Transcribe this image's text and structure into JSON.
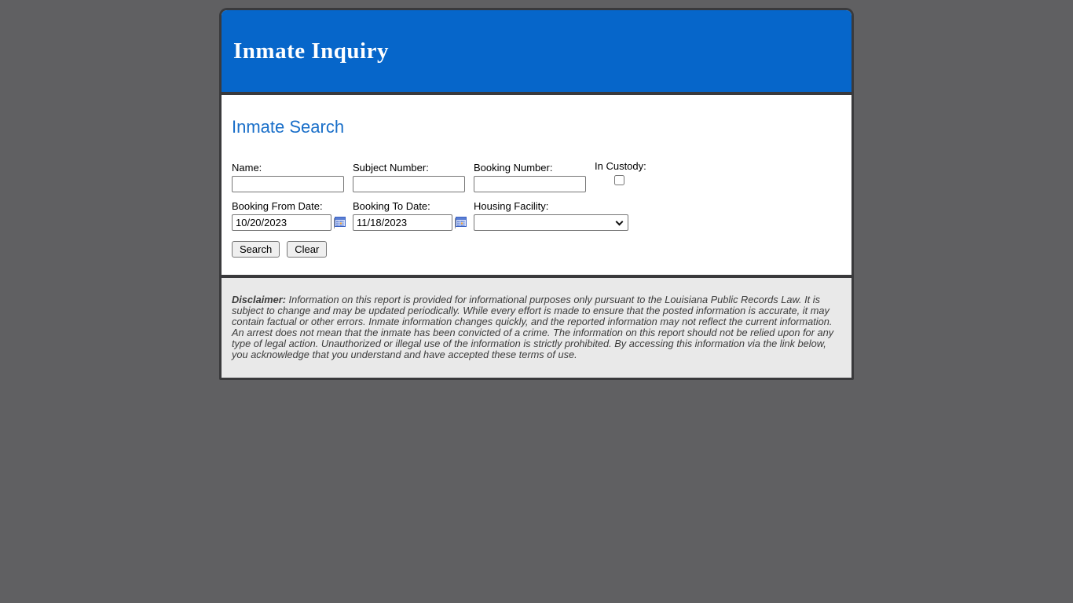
{
  "header": {
    "title": "Inmate Inquiry"
  },
  "search": {
    "heading": "Inmate Search",
    "fields": {
      "name": {
        "label": "Name:",
        "value": ""
      },
      "subject_number": {
        "label": "Subject Number:",
        "value": ""
      },
      "booking_number": {
        "label": "Booking Number:",
        "value": ""
      },
      "in_custody": {
        "label": "In Custody:",
        "checked": false
      },
      "booking_from": {
        "label": "Booking From Date:",
        "value": "10/20/2023"
      },
      "booking_to": {
        "label": "Booking To Date:",
        "value": "11/18/2023"
      },
      "housing_facility": {
        "label": "Housing Facility:",
        "value": ""
      }
    },
    "buttons": {
      "search": "Search",
      "clear": "Clear"
    }
  },
  "disclaimer": {
    "label": "Disclaimer:",
    "text": " Information on this report is provided for informational purposes only pursuant to the Louisiana Public Records Law. It is subject to change and may be updated periodically. While every effort is made to ensure that the posted information is accurate, it may contain factual or other errors. Inmate information changes quickly, and the reported information may not reflect the current information. An arrest does not mean that the inmate has been convicted of a crime. The information on this report should not be relied upon for any type of legal action. Unauthorized or illegal use of the information is strictly prohibited. By accessing this information via the link below, you acknowledge that you understand and have accepted these terms of use."
  },
  "colors": {
    "header_background": "#0666CA",
    "heading_text": "#1A6FC9",
    "page_background": "#606062",
    "card_border": "#3a3a3c",
    "disclaimer_background": "#e9e9e9"
  }
}
